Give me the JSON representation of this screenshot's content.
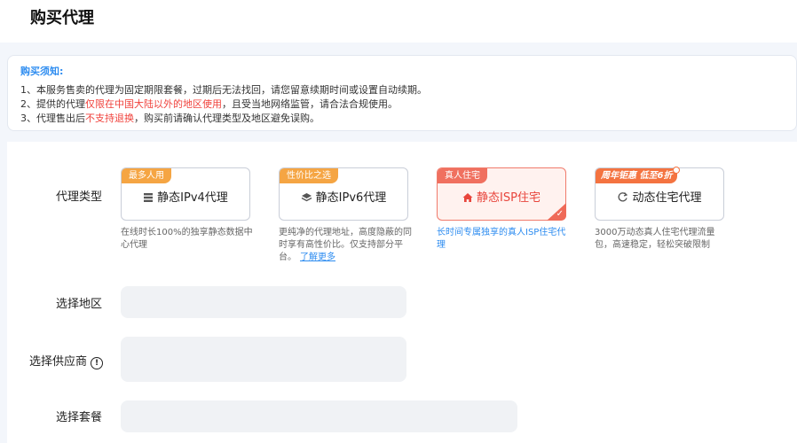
{
  "page": {
    "title": "购买代理"
  },
  "notice": {
    "title": "购买须知:",
    "line1": "1、本服务售卖的代理为固定期限套餐，过期后无法找回，请您留意续期时间或设置自动续期。",
    "line2_prefix": "2、提供的代理",
    "line2_highlight": "仅限在中国大陆以外的地区使用",
    "line2_suffix": "，且受当地网络监管，请合法合规使用。",
    "line3_prefix": "3、代理售出后",
    "line3_highlight": "不支持退换",
    "line3_suffix": "，购买前请确认代理类型及地区避免误购。",
    "highlight_color": "#f0423c"
  },
  "form": {
    "proxy_type_label": "代理类型",
    "region_label": "选择地区",
    "provider_label": "选择供应商",
    "provider_info_icon": "!",
    "package_label": "选择套餐"
  },
  "cards": [
    {
      "tag": "最多人用",
      "name": "静态IPv4代理",
      "icon": "server-icon",
      "desc": "在线时长100%的独享静态数据中心代理",
      "selected": false
    },
    {
      "tag": "性价比之选",
      "name": "静态IPv6代理",
      "icon": "layers-icon",
      "desc": "更纯净的代理地址，高度隐蔽的同时享有高性价比。仅支持部分平台。",
      "desc_link": "了解更多",
      "selected": false
    },
    {
      "tag": "真人住宅",
      "name": "静态ISP住宅",
      "icon": "home-icon",
      "desc": "长时间专属独享的真人ISP住宅代理",
      "selected": true
    },
    {
      "tag": "周年钜惠 低至6折",
      "name": "动态住宅代理",
      "icon": "refresh-icon",
      "desc": "3000万动态真人住宅代理流量包，高速稳定，轻松突破限制",
      "selected": false
    }
  ],
  "colors": {
    "accent_blue": "#2d8cf0",
    "selected_red": "#ef6a58",
    "tag_orange": "#f5a543"
  }
}
